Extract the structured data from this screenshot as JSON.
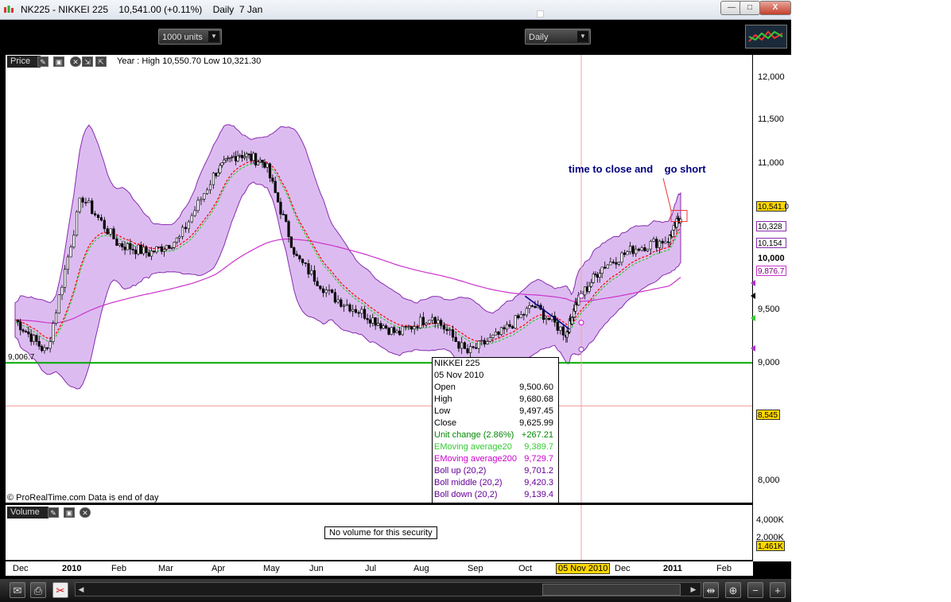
{
  "window": {
    "title": "NK225 - NIKKEI 225    10,541.00 (+0.11%)    Daily  7 Jan",
    "minimize": "—",
    "maximize": "□",
    "close": "X"
  },
  "toolbar": {
    "units": "1000 units",
    "period": "Daily"
  },
  "price_panel": {
    "label": "Price",
    "year_info": "Year : High 10,550.70 Low 10,321.30",
    "low_marker": "9,006.7",
    "source": "© ProRealTime.com  Data is end of day",
    "annotation": "time to close and    go short"
  },
  "volume_panel": {
    "label": "Volume",
    "message": "No volume for this security"
  },
  "y_axis": [
    "12,000",
    "11,500",
    "11,000",
    "10,000",
    "9,500",
    "9,000",
    "8,000"
  ],
  "y_axis_bold": "10,000",
  "volume_axis": [
    "4,000K",
    "2,000K"
  ],
  "value_tags": {
    "last": "10,541.0",
    "boll_up": "10,328",
    "boll_down": "10,154",
    "ema200": "9,876.7",
    "crosshair": "8,545",
    "volume": "1,461K"
  },
  "x_axis": [
    "Dec",
    "2010",
    "Feb",
    "Mar",
    "Apr",
    "May",
    "Jun",
    "Jul",
    "Aug",
    "Sep",
    "Oct",
    "Dec",
    "2011",
    "Feb"
  ],
  "x_axis_cursor": "05 Nov 2010",
  "tooltip": {
    "title": "NIKKEI 225",
    "date": "05 Nov 2010",
    "rows": [
      {
        "k": "Open",
        "v": "9,500.60",
        "color": "#000000"
      },
      {
        "k": "High",
        "v": "9,680.68",
        "color": "#000000"
      },
      {
        "k": "Low",
        "v": "9,497.45",
        "color": "#000000"
      },
      {
        "k": "Close",
        "v": "9,625.99",
        "color": "#000000"
      },
      {
        "k": "Unit change (2.86%)",
        "v": "+267.21",
        "color": "#008800"
      },
      {
        "k": "EMoving average20",
        "v": "9,389.7",
        "color": "#33cc33"
      },
      {
        "k": "EMoving average200",
        "v": "9,729.7",
        "color": "#cc00cc"
      },
      {
        "k": "Boll up (20,2)",
        "v": "9,701.2",
        "color": "#660099"
      },
      {
        "k": "Boll middle (20,2)",
        "v": "9,420.3",
        "color": "#660099"
      },
      {
        "k": "Boll down (20,2)",
        "v": "9,139.4",
        "color": "#660099"
      }
    ]
  },
  "colors": {
    "band_fill": "#dcbcf0",
    "band_edge": "#8a2bb0",
    "ema20": "#33cc33",
    "ema200": "#cc33cc",
    "boll_mid": "#ff0000",
    "support": "#00aa00",
    "annotation": "#000080",
    "tag_yellow": "#ffd700"
  },
  "chart_data": {
    "type": "line",
    "title": "",
    "xlabel": "",
    "ylabel": "",
    "ylim": [
      7700,
      12200
    ],
    "x": [
      "2009-12-01",
      "2009-12-20",
      "2010-01-10",
      "2010-02-01",
      "2010-02-20",
      "2010-03-10",
      "2010-04-01",
      "2010-04-15",
      "2010-05-01",
      "2010-05-20",
      "2010-06-10",
      "2010-07-01",
      "2010-07-20",
      "2010-08-10",
      "2010-08-31",
      "2010-09-20",
      "2010-10-10",
      "2010-10-30",
      "2010-11-05",
      "2010-11-20",
      "2010-12-10",
      "2010-12-31",
      "2011-01-07"
    ],
    "series": [
      {
        "values": [
          9450,
          9100,
          10750,
          10250,
          10150,
          10300,
          11000,
          11200,
          11100,
          10100,
          9700,
          9500,
          9300,
          9500,
          9100,
          9300,
          9600,
          9300,
          9626,
          10000,
          10200,
          10300,
          10541
        ]
      }
    ]
  }
}
